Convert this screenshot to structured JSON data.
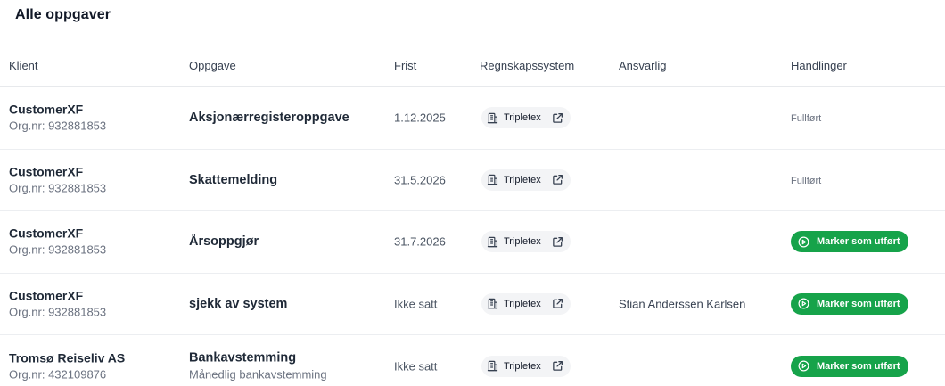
{
  "page": {
    "title": "Alle oppgaver"
  },
  "columns": {
    "client": "Klient",
    "task": "Oppgave",
    "deadline": "Frist",
    "system": "Regnskapssystem",
    "responsible": "Ansvarlig",
    "actions": "Handlinger"
  },
  "rows": [
    {
      "client": "CustomerXF",
      "org": "Org.nr: 932881853",
      "task": "Aksjonærregisteroppgave",
      "task_sub": "",
      "deadline": "1.12.2025",
      "system": "Tripletex",
      "responsible": "",
      "action_type": "done",
      "action_label": "Fullført"
    },
    {
      "client": "CustomerXF",
      "org": "Org.nr: 932881853",
      "task": "Skattemelding",
      "task_sub": "",
      "deadline": "31.5.2026",
      "system": "Tripletex",
      "responsible": "",
      "action_type": "done",
      "action_label": "Fullført"
    },
    {
      "client": "CustomerXF",
      "org": "Org.nr: 932881853",
      "task": "Årsoppgjør",
      "task_sub": "",
      "deadline": "31.7.2026",
      "system": "Tripletex",
      "responsible": "",
      "action_type": "button",
      "action_label": "Marker som utført"
    },
    {
      "client": "CustomerXF",
      "org": "Org.nr: 932881853",
      "task": "sjekk av system",
      "task_sub": "",
      "deadline": "Ikke satt",
      "system": "Tripletex",
      "responsible": "Stian Anderssen Karlsen",
      "action_type": "button",
      "action_label": "Marker som utført"
    },
    {
      "client": "Tromsø Reiseliv AS",
      "org": "Org.nr: 432109876",
      "task": "Bankavstemming",
      "task_sub": "Månedlig bankavstemming",
      "deadline": "Ikke satt",
      "system": "Tripletex",
      "responsible": "",
      "action_type": "button",
      "action_label": "Marker som utført"
    }
  ],
  "icons": {
    "system": "building-icon",
    "external": "external-link-icon",
    "button": "play-circle-icon"
  },
  "colors": {
    "accent_green": "#16a34a",
    "pill_bg": "#f3f4f6"
  }
}
